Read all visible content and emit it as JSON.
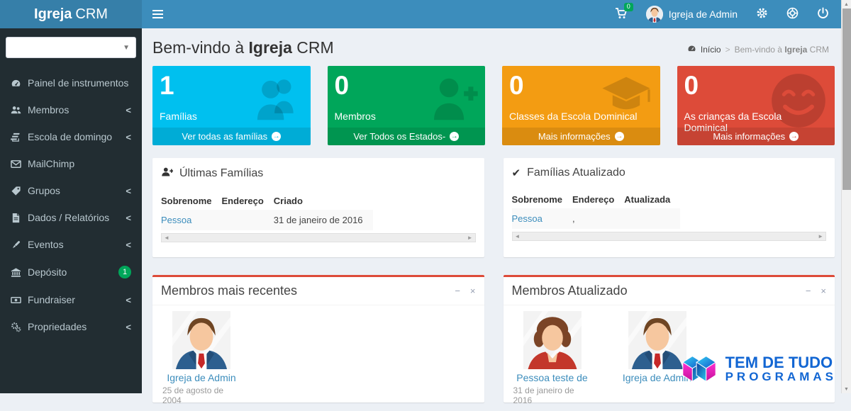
{
  "navbar": {
    "brand_bold": "Igreja",
    "brand_rest": "CRM",
    "cart_badge": "0",
    "user_name": "Igreja de Admin"
  },
  "sidebar": {
    "items": [
      {
        "label": "Painel de instrumentos"
      },
      {
        "label": "Membros"
      },
      {
        "label": "Escola de domingo"
      },
      {
        "label": "MailChimp"
      },
      {
        "label": "Grupos"
      },
      {
        "label": "Dados / Relatórios"
      },
      {
        "label": "Eventos"
      },
      {
        "label": "Depósito",
        "badge": "1"
      },
      {
        "label": "Fundraiser"
      },
      {
        "label": "Propriedades"
      }
    ],
    "chevron": "<"
  },
  "header": {
    "title_prefix": "Bem-vindo à ",
    "title_bold": "Igreja",
    "title_suffix": " CRM",
    "breadcrumb": {
      "home": "Início",
      "sep": ">",
      "current_prefix": "Bem-vindo à ",
      "current_bold": "Igreja",
      "current_suffix": " CRM"
    }
  },
  "info_boxes": [
    {
      "value": "1",
      "label": "Famílias",
      "footer": "Ver todas as famílias",
      "color": "#00c0ef"
    },
    {
      "value": "0",
      "label": "Membros",
      "footer": "Ver Todos os Estados-",
      "color": "#00a65a"
    },
    {
      "value": "0",
      "label": "Classes da Escola Dominical",
      "footer": "Mais informações",
      "color": "#f39c12"
    },
    {
      "value": "0",
      "label": "As crianças da Escola Dominical",
      "footer": "Mais informações",
      "color": "#dd4b39"
    }
  ],
  "panels": {
    "latest_families": {
      "title": "Últimas Famílias",
      "columns": [
        "Sobrenome",
        "Endereço",
        "Criado"
      ],
      "rows": [
        {
          "sobrenome": "Pessoa",
          "endereco": "",
          "data": "31 de janeiro de 2016"
        }
      ]
    },
    "updated_families": {
      "title": "Famílias Atualizado",
      "columns": [
        "Sobrenome",
        "Endereço",
        "Atualizada"
      ],
      "rows": [
        {
          "sobrenome": "Pessoa",
          "endereco": ",",
          "data": ""
        }
      ]
    }
  },
  "member_boxes": {
    "recent": {
      "title": "Membros mais recentes",
      "members": [
        {
          "name": "Igreja de Admin",
          "date": "25 de agosto de 2004"
        }
      ]
    },
    "updated": {
      "title": "Membros Atualizado",
      "members": [
        {
          "name": "Pessoa teste de",
          "date": "31 de janeiro de 2016"
        },
        {
          "name": "Igreja de Admin",
          "date": ""
        }
      ]
    }
  },
  "watermark": {
    "line1": "TEM DE TUDO",
    "line2": "PROGRAMAS"
  },
  "colors": {
    "navbar": "#3c8dbc",
    "brand": "#367fa9",
    "sidebar": "#222d32",
    "content_bg": "#ecf0f5",
    "link": "#3c8dbc",
    "box_border": "#dd4b39",
    "badge": "#00a65a"
  }
}
